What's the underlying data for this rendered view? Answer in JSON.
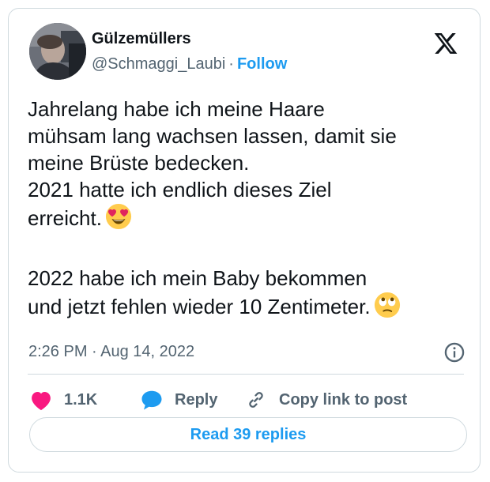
{
  "tweet": {
    "author": {
      "display_name": "Gülzemüllers",
      "handle": "@Schmaggi_Laubi",
      "separator": "·",
      "follow_label": "Follow"
    },
    "platform_icon": "x-logo-icon",
    "text": {
      "line1": "Jahrelang habe ich meine Haare",
      "line2": "mühsam lang wachsen lassen, damit sie",
      "line3": "meine Brüste bedecken.",
      "line4": "2021 hatte ich endlich dieses Ziel",
      "line5": "erreicht.",
      "line5_emoji": "smiling-face-with-heart-eyes",
      "line6": "2022 habe ich mein Baby bekommen",
      "line7": "und jetzt fehlen wieder 10 Zentimeter.",
      "line7_emoji": "face-with-rolling-eyes"
    },
    "timestamp": "2:26 PM · Aug 14, 2022",
    "actions": {
      "like_count": "1.1K",
      "reply_label": "Reply",
      "copy_link_label": "Copy link to post"
    },
    "read_replies_label": "Read 39 replies"
  },
  "colors": {
    "accent": "#1d9bf0",
    "like": "#f91880",
    "text_primary": "#0f1419",
    "text_secondary": "#536471",
    "border": "#cfd9de"
  }
}
